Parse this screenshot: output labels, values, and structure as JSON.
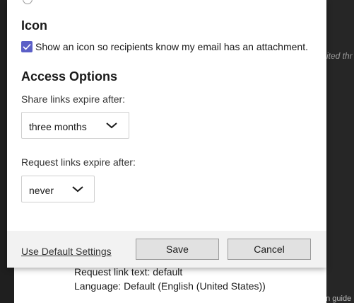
{
  "background": {
    "right_text_top": "ited thr",
    "right_text_bottom": "en guide i",
    "lines": [
      "Request link text: default",
      "Language: Default (English (United States))"
    ]
  },
  "icon_section": {
    "heading": "Icon",
    "checkbox_checked": true,
    "checkbox_label": "Show an icon so recipients know my email has an attachment."
  },
  "access_options": {
    "heading": "Access Options",
    "share_label": "Share links expire after:",
    "share_value": "three months",
    "request_label": "Request links expire after:",
    "request_value": "never"
  },
  "footer": {
    "default_link": "Use Default Settings",
    "save_label": "Save",
    "cancel_label": "Cancel"
  },
  "colors": {
    "accent": "#5b5fc7",
    "footer_bg": "#f2f2f2",
    "button_bg": "#e1e1e1"
  }
}
